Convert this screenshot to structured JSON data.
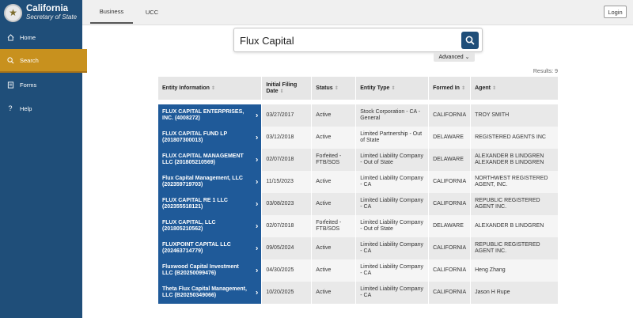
{
  "brand": {
    "title": "California",
    "subtitle": "Secretary of State"
  },
  "sidebar": {
    "items": [
      {
        "label": "Home",
        "icon": "home-icon"
      },
      {
        "label": "Search",
        "icon": "search-icon"
      },
      {
        "label": "Forms",
        "icon": "forms-icon"
      },
      {
        "label": "Help",
        "icon": "help-icon"
      }
    ]
  },
  "topbar": {
    "tabs": [
      {
        "label": "Business"
      },
      {
        "label": "UCC"
      }
    ],
    "login_label": "Login"
  },
  "search": {
    "value": "Flux Capital",
    "advanced_label": "Advanced"
  },
  "results": {
    "count_text": "Results: 9",
    "headers": {
      "entity": "Entity Information",
      "date": "Initial Filing Date",
      "status": "Status",
      "type": "Entity Type",
      "formed": "Formed In",
      "agent": "Agent"
    },
    "rows": [
      {
        "entity": "FLUX CAPITAL ENTERPRISES, INC. (4008272)",
        "date": "03/27/2017",
        "status": "Active",
        "type": "Stock Corporation - CA - General",
        "formed": "CALIFORNIA",
        "agent": "TROY  SMITH"
      },
      {
        "entity": "FLUX CAPITAL FUND LP (201807300013)",
        "date": "03/12/2018",
        "status": "Active",
        "type": "Limited Partnership - Out of State",
        "formed": "DELAWARE",
        "agent": "REGISTERED AGENTS INC"
      },
      {
        "entity": "FLUX CAPITAL MANAGEMENT LLC (201805210569)",
        "date": "02/07/2018",
        "status": "Forfeited - FTB/SOS",
        "type": "Limited Liability Company - Out of State",
        "formed": "DELAWARE",
        "agent": "ALEXANDER B LINDGREN ALEXANDER B LINDGREN"
      },
      {
        "entity": "Flux Capital Management, LLC (202359719703)",
        "date": "11/15/2023",
        "status": "Active",
        "type": "Limited Liability Company - CA",
        "formed": "CALIFORNIA",
        "agent": "NORTHWEST REGISTERED AGENT, INC."
      },
      {
        "entity": "FLUX CAPITAL RE 1 LLC (202355518121)",
        "date": "03/08/2023",
        "status": "Active",
        "type": "Limited Liability Company - CA",
        "formed": "CALIFORNIA",
        "agent": "REPUBLIC REGISTERED AGENT INC."
      },
      {
        "entity": "FLUX CAPITAL, LLC (201805210562)",
        "date": "02/07/2018",
        "status": "Forfeited - FTB/SOS",
        "type": "Limited Liability Company - Out of State",
        "formed": "DELAWARE",
        "agent": "ALEXANDER B LINDGREN"
      },
      {
        "entity": "FLUXPOINT CAPITAL LLC (202463714779)",
        "date": "09/05/2024",
        "status": "Active",
        "type": "Limited Liability Company - CA",
        "formed": "CALIFORNIA",
        "agent": "REPUBLIC REGISTERED AGENT INC."
      },
      {
        "entity": "Fluxwood Capital Investment LLC (B20250099476)",
        "date": "04/30/2025",
        "status": "Active",
        "type": "Limited Liability Company - CA",
        "formed": "CALIFORNIA",
        "agent": "Heng Zhang"
      },
      {
        "entity": "Theta Flux Capital Management, LLC (B20250349066)",
        "date": "10/20/2025",
        "status": "Active",
        "type": "Limited Liability Company - CA",
        "formed": "CALIFORNIA",
        "agent": "Jason H Rupe"
      }
    ]
  },
  "colors": {
    "navy": "#1f4e79",
    "entity_blue": "#1f5a99",
    "accent_gold": "#c8911e"
  }
}
